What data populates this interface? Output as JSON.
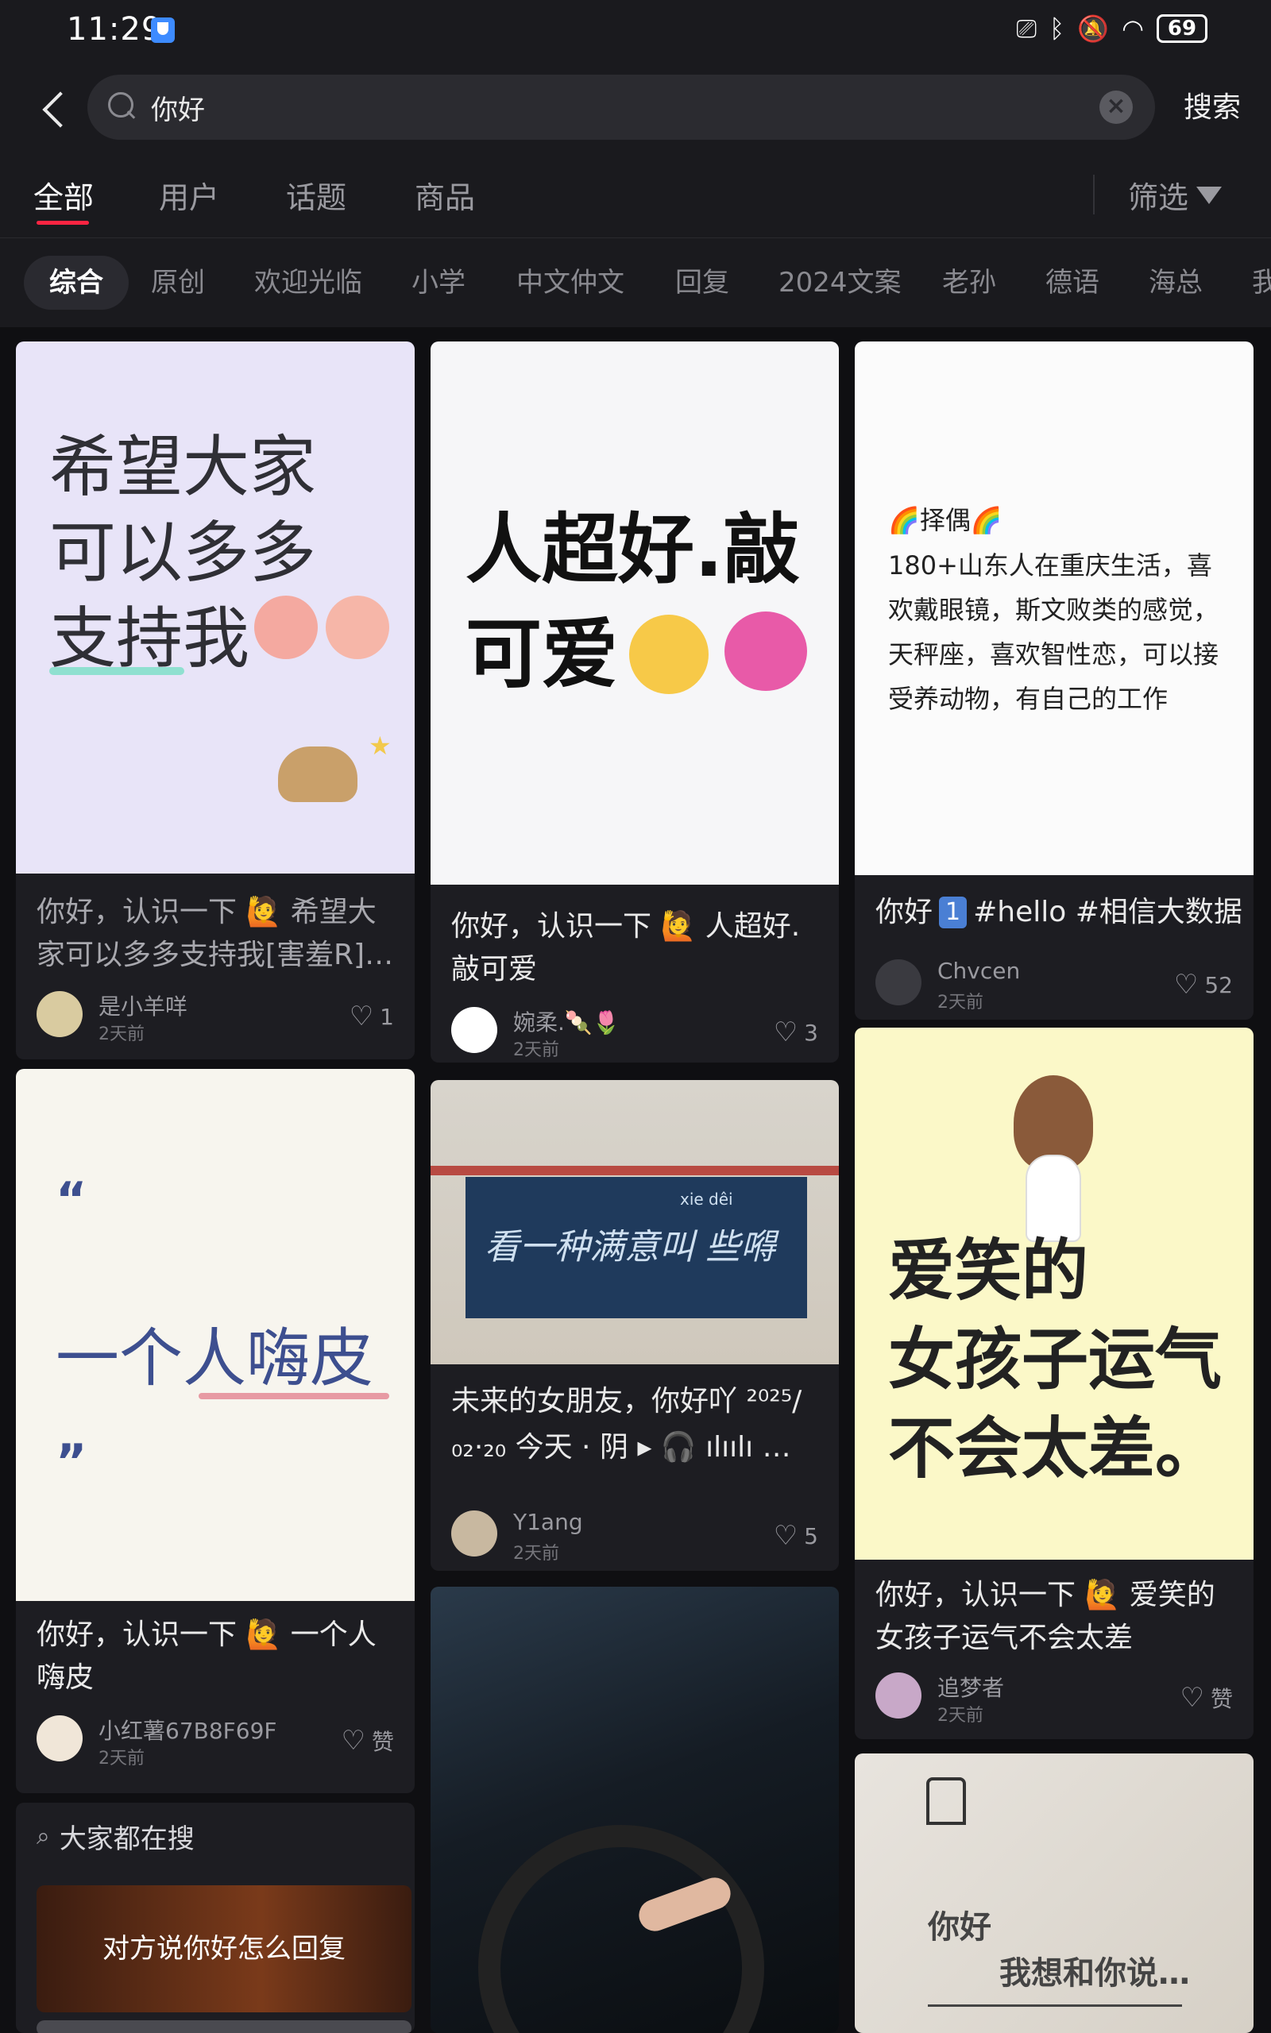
{
  "status_bar": {
    "time": "11:29",
    "battery": "69"
  },
  "search": {
    "query": "你好",
    "placeholder": "搜索",
    "submit_label": "搜索"
  },
  "tabs": [
    {
      "label": "全部",
      "active": true
    },
    {
      "label": "用户"
    },
    {
      "label": "话题"
    },
    {
      "label": "商品"
    }
  ],
  "filter": {
    "label": "筛选"
  },
  "chips": [
    "综合",
    "原创",
    "欢迎光临",
    "小学",
    "中文仲文",
    "回复",
    "2024文案",
    "老孙",
    "德语",
    "海总",
    "我"
  ],
  "cards": {
    "c1": {
      "cover_lines": [
        "希望大家",
        "可以多多",
        "支持我"
      ],
      "title": "你好，认识一下 🙋 希望大家可以多多支持我[害羞R]…",
      "author": "是小羊咩",
      "time": "2天前",
      "likes": "1"
    },
    "c2": {
      "cover_lines": [
        "人超好.敲",
        "可爱"
      ],
      "title": "你好，认识一下 🙋 人超好.敲可爱",
      "author": "婉柔.🍡🌷",
      "time": "2天前",
      "likes": "3"
    },
    "c3": {
      "cover_heading": "🌈择偶🌈",
      "cover_body": "180+山东人在重庆生活，喜欢戴眼镜，斯文败类的感觉，天秤座，喜欢智性恋，可以接受养动物，有自己的工作",
      "title_prefix": "你好",
      "title_badge": "1",
      "title_suffix": "#hello #相信大数据",
      "author": "Chvcen",
      "time": "2天前",
      "likes": "52"
    },
    "c4": {
      "cover_text": "一个人嗨皮",
      "title": "你好，认识一下 🙋 一个人嗨皮",
      "author": "小红薯67B8F69F",
      "time": "2天前",
      "likes": "赞"
    },
    "c5": {
      "cover_sign": "看一种满意叫 些嘚",
      "cover_pinyin": "xie    dêi",
      "title_line1": "未来的女朋友，你好吖 ²⁰²⁵/",
      "title_line2": "₀₂·₂₀ 今天 · 阴 ▸ 🎧 ılıılı …",
      "author": "Y1ang",
      "time": "2天前",
      "likes": "5"
    },
    "c6": {
      "cover_lines": [
        "爱笑的",
        "女孩子运气",
        "不会太差。"
      ],
      "title": "你好，认识一下 🙋 爱笑的女孩子运气不会太差",
      "author": "追梦者",
      "time": "2天前",
      "likes": "赞"
    },
    "c7": {
      "cover_line1": "你好",
      "cover_line2": "我想和你说…"
    }
  },
  "trending": {
    "title": "大家都在搜",
    "item": "对方说你好怎么回复"
  },
  "colors": {
    "accent": "#ff2442",
    "background": "#0f0f12",
    "card": "#1d1d22"
  }
}
